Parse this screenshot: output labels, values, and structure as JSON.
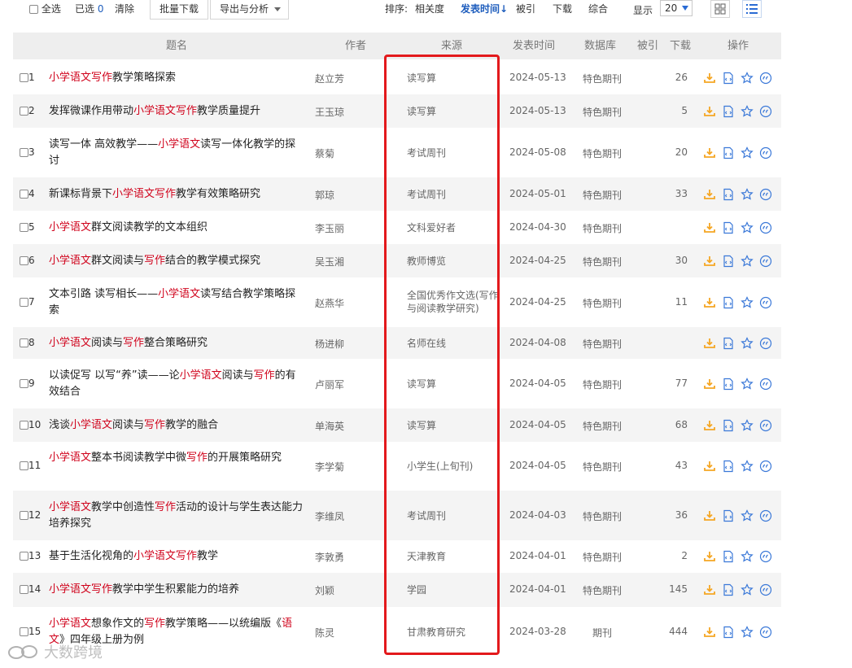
{
  "toolbar": {
    "select_all": "全选",
    "selected_label": "已选",
    "selected_count": "0",
    "clear": "清除",
    "batch_download": "批量下载",
    "export": "导出与分析",
    "sort_label": "排序:",
    "sort_relevance": "相关度",
    "sort_date": "发表时间",
    "sort_cited": "被引",
    "sort_download": "下载",
    "sort_combined": "综合",
    "display_label": "显示",
    "display_count": "20"
  },
  "columns": {
    "title": "题名",
    "author": "作者",
    "source": "来源",
    "date": "发表时间",
    "database": "数据库",
    "cited": "被引",
    "downloads": "下载",
    "actions": "操作"
  },
  "rows": [
    {
      "num": "1",
      "title": [
        {
          "t": "小学语文写作",
          "h": true
        },
        {
          "t": "教学策略探索",
          "h": false
        }
      ],
      "author": "赵立芳",
      "source": "读写算",
      "date": "2024-05-13",
      "db": "特色期刊",
      "cited": "",
      "dl": "26"
    },
    {
      "num": "2",
      "title": [
        {
          "t": "发挥微课作用带动",
          "h": false
        },
        {
          "t": "小学语文写作",
          "h": true
        },
        {
          "t": "教学质量提升",
          "h": false
        }
      ],
      "author": "王玉琼",
      "source": "读写算",
      "date": "2024-05-13",
      "db": "特色期刊",
      "cited": "",
      "dl": "5"
    },
    {
      "num": "3",
      "title": [
        {
          "t": "读写一体 高效教学——",
          "h": false
        },
        {
          "t": "小学语文",
          "h": true
        },
        {
          "t": "读写一体化教学的探讨",
          "h": false
        }
      ],
      "author": "蔡菊",
      "source": "考试周刊",
      "date": "2024-05-08",
      "db": "特色期刊",
      "cited": "",
      "dl": "20"
    },
    {
      "num": "4",
      "title": [
        {
          "t": "新课标背景下",
          "h": false
        },
        {
          "t": "小学语文写作",
          "h": true
        },
        {
          "t": "教学有效策略研究",
          "h": false
        }
      ],
      "author": "郭琼",
      "source": "考试周刊",
      "date": "2024-05-01",
      "db": "特色期刊",
      "cited": "",
      "dl": "33"
    },
    {
      "num": "5",
      "title": [
        {
          "t": "小学语文",
          "h": true
        },
        {
          "t": "群文阅读教学的文本组织",
          "h": false
        }
      ],
      "author": "李玉丽",
      "source": "文科爱好者",
      "date": "2024-04-30",
      "db": "特色期刊",
      "cited": "",
      "dl": ""
    },
    {
      "num": "6",
      "title": [
        {
          "t": "小学语文",
          "h": true
        },
        {
          "t": "群文阅读与",
          "h": false
        },
        {
          "t": "写作",
          "h": true
        },
        {
          "t": "结合的教学模式探究",
          "h": false
        }
      ],
      "author": "吴玉湘",
      "source": "教师博览",
      "date": "2024-04-25",
      "db": "特色期刊",
      "cited": "",
      "dl": "30"
    },
    {
      "num": "7",
      "title": [
        {
          "t": "文本引路 读写相长——",
          "h": false
        },
        {
          "t": "小学语文",
          "h": true
        },
        {
          "t": "读写结合教学策略探索",
          "h": false
        }
      ],
      "author": "赵燕华",
      "source": "全国优秀作文选(写作与阅读教学研究)",
      "date": "2024-04-25",
      "db": "特色期刊",
      "cited": "",
      "dl": "11"
    },
    {
      "num": "8",
      "title": [
        {
          "t": "小学语文",
          "h": true
        },
        {
          "t": "阅读与",
          "h": false
        },
        {
          "t": "写作",
          "h": true
        },
        {
          "t": "整合策略研究",
          "h": false
        }
      ],
      "author": "杨进柳",
      "source": "名师在线",
      "date": "2024-04-08",
      "db": "特色期刊",
      "cited": "",
      "dl": ""
    },
    {
      "num": "9",
      "title": [
        {
          "t": "以读促写 以写“养”读——论",
          "h": false
        },
        {
          "t": "小学语文",
          "h": true
        },
        {
          "t": "阅读与",
          "h": false
        },
        {
          "t": "写作",
          "h": true
        },
        {
          "t": "的有效结合",
          "h": false
        }
      ],
      "author": "卢丽军",
      "source": "读写算",
      "date": "2024-04-05",
      "db": "特色期刊",
      "cited": "",
      "dl": "77"
    },
    {
      "num": "10",
      "title": [
        {
          "t": "浅谈",
          "h": false
        },
        {
          "t": "小学语文",
          "h": true
        },
        {
          "t": "阅读与",
          "h": false
        },
        {
          "t": "写作",
          "h": true
        },
        {
          "t": "教学的融合",
          "h": false
        }
      ],
      "author": "单海英",
      "source": "读写算",
      "date": "2024-04-05",
      "db": "特色期刊",
      "cited": "",
      "dl": "68"
    },
    {
      "num": "11",
      "title": [
        {
          "t": "小学语文",
          "h": true
        },
        {
          "t": "整本书阅读教学中微",
          "h": false
        },
        {
          "t": "写作",
          "h": true
        },
        {
          "t": "的开展策略研究",
          "h": false
        }
      ],
      "author": "李学菊",
      "source": "小学生(上旬刊)",
      "date": "2024-04-05",
      "db": "特色期刊",
      "cited": "",
      "dl": "43"
    },
    {
      "num": "12",
      "title": [
        {
          "t": "小学语文",
          "h": true
        },
        {
          "t": "教学中创造性",
          "h": false
        },
        {
          "t": "写作",
          "h": true
        },
        {
          "t": "活动的设计与学生表达能力培养探究",
          "h": false
        }
      ],
      "author": "李维凤",
      "source": "考试周刊",
      "date": "2024-04-03",
      "db": "特色期刊",
      "cited": "",
      "dl": "36"
    },
    {
      "num": "13",
      "title": [
        {
          "t": "基于生活化视角的",
          "h": false
        },
        {
          "t": "小学语文写作",
          "h": true
        },
        {
          "t": "教学",
          "h": false
        }
      ],
      "author": "李敦勇",
      "source": "天津教育",
      "date": "2024-04-01",
      "db": "特色期刊",
      "cited": "",
      "dl": "2"
    },
    {
      "num": "14",
      "title": [
        {
          "t": "小学语文写作",
          "h": true
        },
        {
          "t": "教学中学生积累能力的培养",
          "h": false
        }
      ],
      "author": "刘颖",
      "source": "学园",
      "date": "2024-04-01",
      "db": "特色期刊",
      "cited": "",
      "dl": "145"
    },
    {
      "num": "15",
      "title": [
        {
          "t": "小学语文",
          "h": true
        },
        {
          "t": "想象作文的",
          "h": false
        },
        {
          "t": "写作",
          "h": true
        },
        {
          "t": "教学策略——以统编版《",
          "h": false
        },
        {
          "t": "语文",
          "h": true
        },
        {
          "t": "》四年级上册为例",
          "h": false
        }
      ],
      "author": "陈灵",
      "source": "甘肃教育研究",
      "date": "2024-03-28",
      "db": "期刊",
      "cited": "",
      "dl": "444"
    }
  ],
  "watermark": "大数跨境",
  "colors": {
    "highlight": "#d0021b",
    "link_blue": "#1e5dbd",
    "action_orange": "#f5a623",
    "annotation_red": "#e3191c"
  }
}
